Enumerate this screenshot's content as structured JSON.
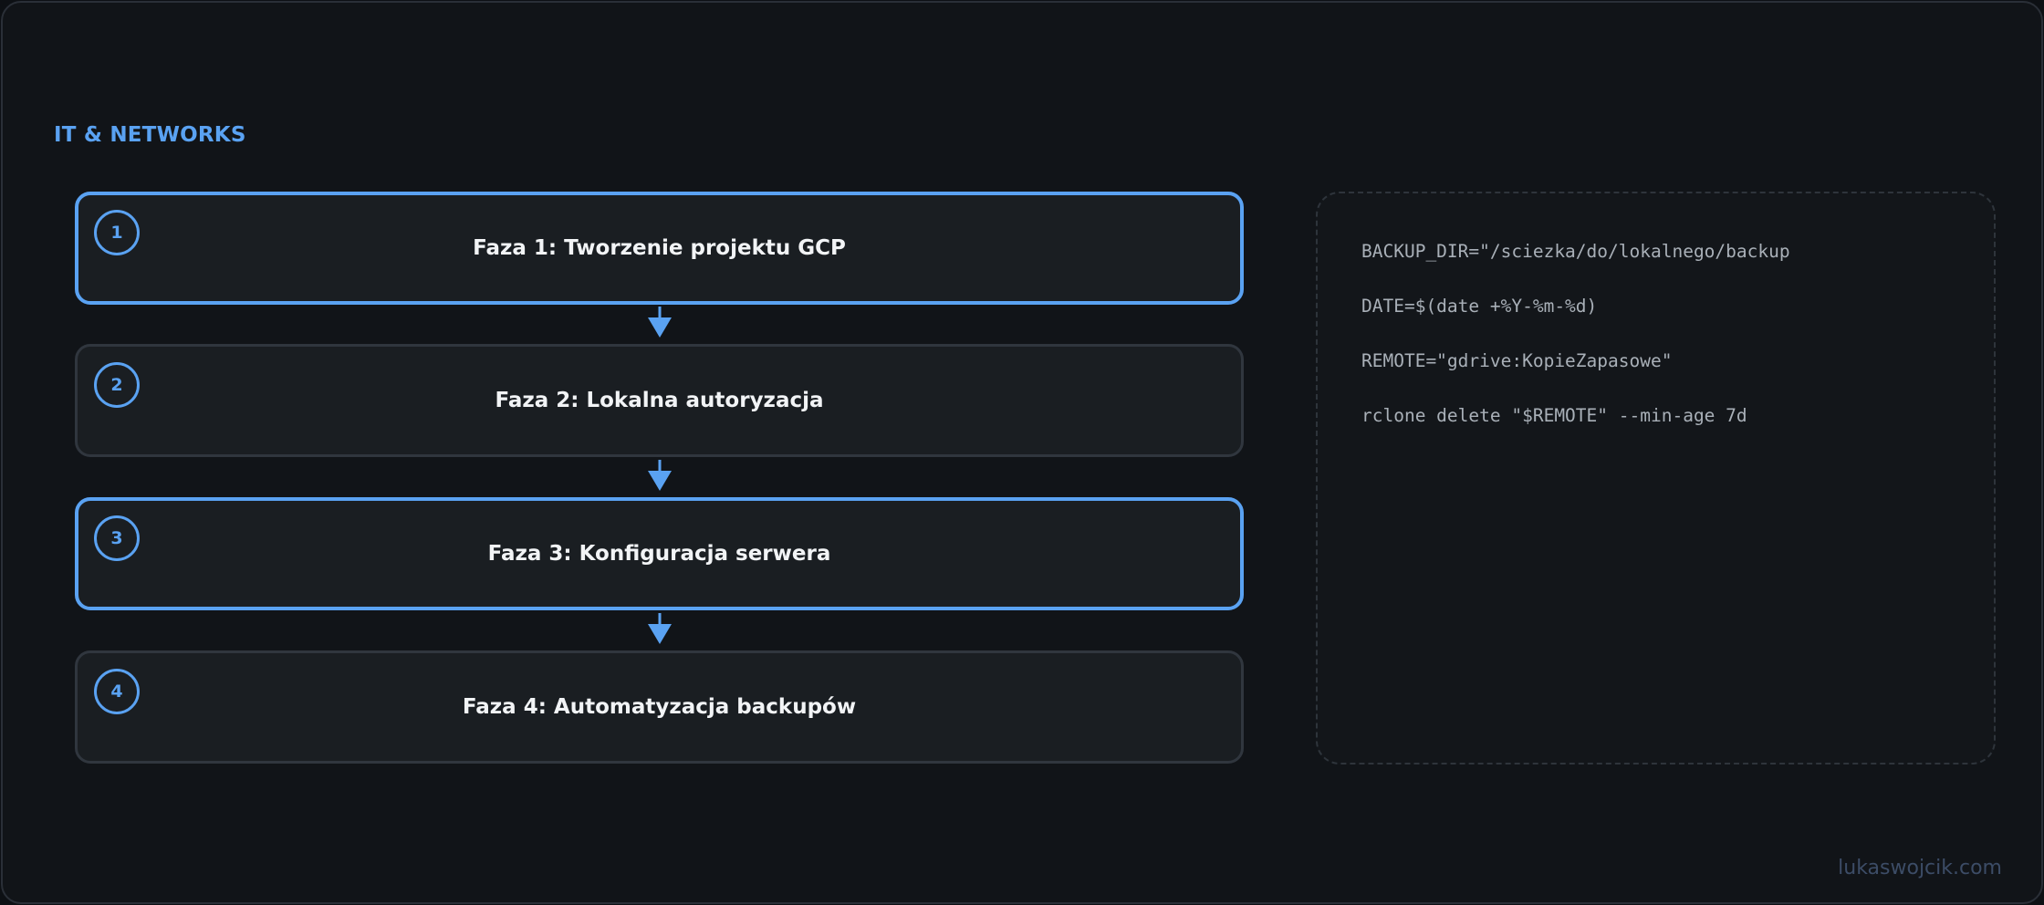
{
  "category": "IT & NETWORKS",
  "phases": [
    {
      "number": "1",
      "title": "Faza 1: Tworzenie projektu GCP",
      "highlighted": true
    },
    {
      "number": "2",
      "title": "Faza 2: Lokalna autoryzacja",
      "highlighted": false
    },
    {
      "number": "3",
      "title": "Faza 3: Konfiguracja serwera",
      "highlighted": true
    },
    {
      "number": "4",
      "title": "Faza 4: Automatyzacja backupów",
      "highlighted": false
    }
  ],
  "code_lines": [
    "BACKUP_DIR=\"/sciezka/do/lokalnego/backup",
    "DATE=$(date +%Y-%m-%d)",
    "REMOTE=\"gdrive:KopieZapasowe\"",
    "rclone delete \"$REMOTE\" --min-age 7d"
  ],
  "watermark": "lukaswojcik.com",
  "colors": {
    "accent": "#5aa2f2",
    "background": "#111418",
    "card": "#1a1e22",
    "text": "#f2f4f6",
    "code_text": "#a9b0b8"
  }
}
